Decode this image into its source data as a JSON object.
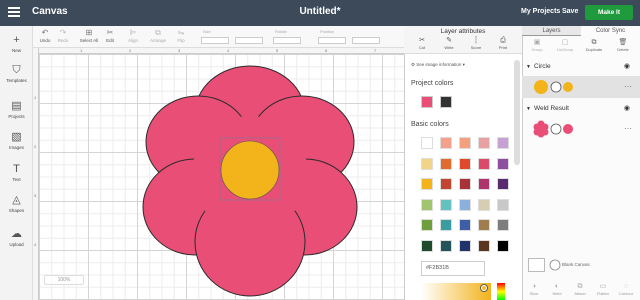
{
  "header": {
    "app_title": "Canvas",
    "doc_title": "Untitled*",
    "my_projects": "My Projects",
    "save": "Save",
    "make_it": "Make It"
  },
  "left_toolbar": {
    "items": [
      {
        "label": "New",
        "icon": "plus-icon"
      },
      {
        "label": "Templates",
        "icon": "shirt-icon"
      },
      {
        "label": "Projects",
        "icon": "projects-icon"
      },
      {
        "label": "Images",
        "icon": "image-icon"
      },
      {
        "label": "Text",
        "icon": "text-icon"
      },
      {
        "label": "Shapes",
        "icon": "shapes-icon"
      },
      {
        "label": "Upload",
        "icon": "upload-icon"
      }
    ]
  },
  "edit_toolbar": {
    "undo": "Undo",
    "redo": "Redo",
    "select_all": "Select All",
    "edit": "Edit",
    "align": "Align",
    "arrange": "Arrange",
    "flip": "Flip",
    "size": "Size",
    "rotate": "Rotate",
    "position": "Position"
  },
  "canvas": {
    "zoom_label": "100%",
    "ruler_top": [
      "1",
      "2",
      "3",
      "4",
      "5",
      "6",
      "7"
    ],
    "ruler_left": [
      "1",
      "2",
      "3",
      "4"
    ],
    "flower_color": "#E84E76",
    "center_color": "#F2B31B"
  },
  "attributes_panel": {
    "title": "Layer attributes",
    "buttons": [
      "Cut",
      "Write",
      "Score",
      "Print"
    ],
    "see_info": "See image information",
    "project_colors_label": "Project colors",
    "project_colors": [
      "#E84E76",
      "#333333"
    ],
    "basic_colors_label": "Basic colors",
    "basic_colors": [
      "#ffffff",
      "#f4a08a",
      "#f4a07f",
      "#e9a0a0",
      "#c7a0d4",
      "#f1d486",
      "#e26a2c",
      "#e04a2c",
      "#dc4a6a",
      "#8e4fa0",
      "#f2b31b",
      "#c2452f",
      "#a83237",
      "#b1326f",
      "#5a2a6e",
      "#a1c46e",
      "#63c1bf",
      "#8bb0dd",
      "#d7cdb2",
      "#c8c8c8",
      "#6f9e3c",
      "#3a9da1",
      "#3e5fa6",
      "#a07d4f",
      "#7d7d7d",
      "#1f4d2c",
      "#24535a",
      "#20336b",
      "#5a3520",
      "#000000"
    ],
    "hex_value": "#F2B31B"
  },
  "layers_panel": {
    "tabs": [
      "Layers",
      "Color Sync"
    ],
    "actions": [
      {
        "label": "Group",
        "enabled": false
      },
      {
        "label": "UnGroup",
        "enabled": false
      },
      {
        "label": "Duplicate",
        "enabled": true
      },
      {
        "label": "Delete",
        "enabled": true
      }
    ],
    "groups": [
      {
        "name": "Circle",
        "color": "#F2B31B"
      },
      {
        "name": "Weld Result",
        "color": "#E84E76"
      }
    ],
    "blank_canvas": "Blank Canvas",
    "bottom_actions": [
      "Slice",
      "Weld",
      "Attach",
      "Flatten",
      "Contour"
    ]
  }
}
